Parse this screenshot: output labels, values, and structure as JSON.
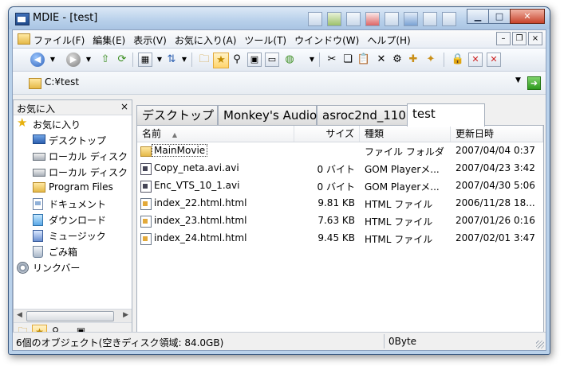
{
  "window": {
    "title": "MDIE - [test]"
  },
  "menu": {
    "items": [
      "ファイル(F)",
      "編集(E)",
      "表示(V)",
      "お気に入り(A)",
      "ツール(T)",
      "ウインドウ(W)",
      "ヘルプ(H)"
    ]
  },
  "address": {
    "path": "C:¥test"
  },
  "favorites": {
    "title": "お気に入",
    "close": "×",
    "items": [
      {
        "label": "お気に入り",
        "icon": "star-icon"
      },
      {
        "label": "デスクトップ",
        "icon": "desktop-icon"
      },
      {
        "label": "ローカル ディスク",
        "icon": "disk-icon"
      },
      {
        "label": "ローカル ディスク",
        "icon": "disk-icon"
      },
      {
        "label": "Program Files",
        "icon": "folder-icon"
      },
      {
        "label": "ドキュメント",
        "icon": "document-icon"
      },
      {
        "label": "ダウンロード",
        "icon": "download-icon"
      },
      {
        "label": "ミュージック",
        "icon": "music-icon"
      },
      {
        "label": "ごみ箱",
        "icon": "trash-icon"
      },
      {
        "label": "リンクバー",
        "icon": "gear-icon"
      }
    ]
  },
  "tabs": [
    "デスクトップ",
    "Monkey's Audio",
    "asroc2nd_110",
    "test"
  ],
  "list": {
    "columns": [
      "名前",
      "サイズ",
      "種類",
      "更新日時"
    ],
    "rows": [
      {
        "name": "MainMovie",
        "size": "",
        "type": "ファイル フォルダ",
        "date": "2007/04/04 0:37",
        "icon": "folder"
      },
      {
        "name": "Copy_neta.avi.avi",
        "size": "0 バイト",
        "type": "GOM Playerメ...",
        "date": "2007/04/23 3:42",
        "icon": "video"
      },
      {
        "name": "Enc_VTS_10_1.avi",
        "size": "0 バイト",
        "type": "GOM Playerメ...",
        "date": "2007/04/30 5:06",
        "icon": "video"
      },
      {
        "name": "index_22.html.html",
        "size": "9.81 KB",
        "type": "HTML ファイル",
        "date": "2006/11/28 18...",
        "icon": "html"
      },
      {
        "name": "index_23.html.html",
        "size": "7.63 KB",
        "type": "HTML ファイル",
        "date": "2007/01/26 0:16",
        "icon": "html"
      },
      {
        "name": "index_24.html.html",
        "size": "9.45 KB",
        "type": "HTML ファイル",
        "date": "2007/02/01 3:47",
        "icon": "html"
      }
    ]
  },
  "status": {
    "objects": "6個のオブジェクト(空きディスク領域: 84.0GB)",
    "size": "0Byte"
  }
}
